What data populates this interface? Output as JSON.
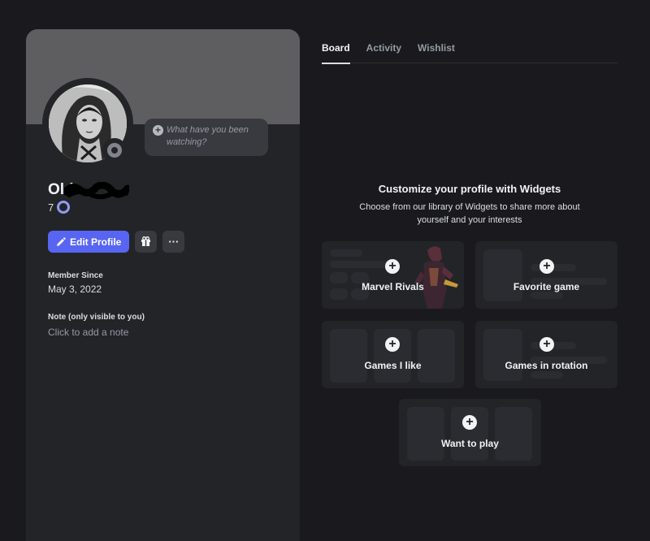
{
  "profile": {
    "display_name": "Old",
    "tag": "7",
    "status_placeholder": "What have you been watching?",
    "edit_profile_label": "Edit Profile",
    "more_label": "···",
    "member_since_label": "Member Since",
    "member_since_value": "May 3, 2022",
    "note_label": "Note (only visible to you)",
    "note_placeholder": "Click to add a note"
  },
  "tabs": [
    {
      "label": "Board",
      "active": true
    },
    {
      "label": "Activity",
      "active": false
    },
    {
      "label": "Wishlist",
      "active": false
    }
  ],
  "board": {
    "title": "Customize your profile with Widgets",
    "subtitle": "Choose from our library of Widgets to share more about yourself and your interests",
    "plus": "+",
    "widgets": [
      {
        "label": "Marvel Rivals"
      },
      {
        "label": "Favorite game"
      },
      {
        "label": "Games I like"
      },
      {
        "label": "Games in rotation"
      },
      {
        "label": "Want to play"
      }
    ]
  },
  "colors": {
    "accent": "#5865f2",
    "background": "#1a1a1e",
    "card": "#232428",
    "banner": "#5e5e61"
  },
  "icons": [
    "pencil-icon",
    "nitro-gift-icon",
    "more-icon",
    "add-circle-icon",
    "status-idle-icon"
  ]
}
